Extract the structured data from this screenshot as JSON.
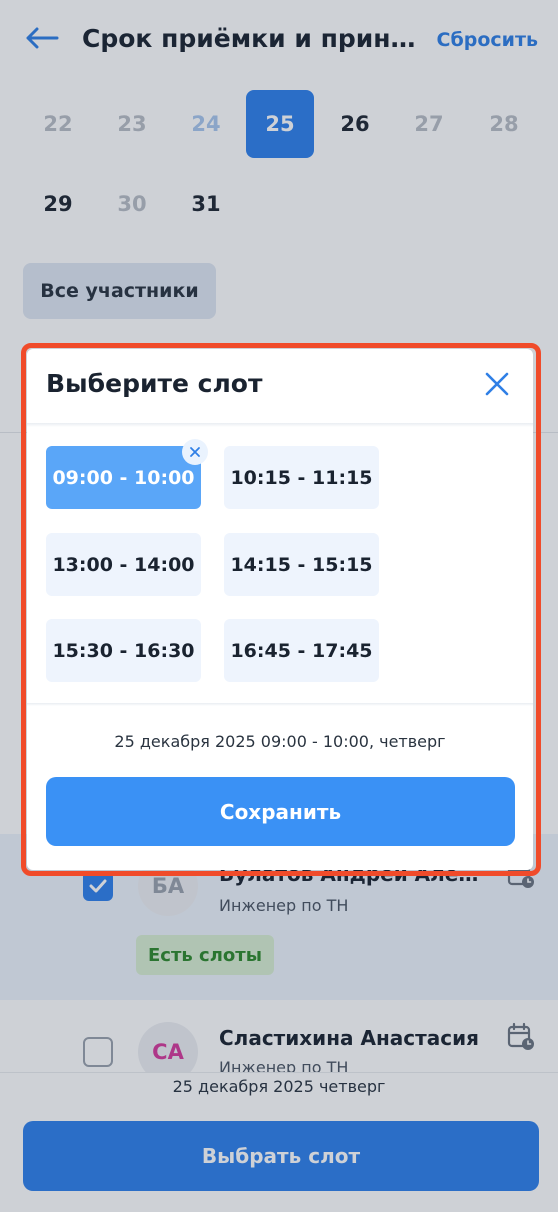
{
  "header": {
    "title": "Срок приёмки и прини...",
    "reset_label": "Сбросить",
    "back_icon": "arrow-left-icon"
  },
  "calendar": {
    "row1": [
      "22",
      "23",
      "24",
      "25",
      "26",
      "27",
      "28"
    ],
    "row2": [
      "29",
      "30",
      "31"
    ],
    "selected_day": "25"
  },
  "filter": {
    "all_participants_label": "Все участники"
  },
  "participants": [
    {
      "initials": "БА",
      "name": "Булатов Андрей Алекса...",
      "role": "Инженер по ТН",
      "checked": true,
      "badge": "Есть слоты",
      "initials_color": "#9aa2ad"
    },
    {
      "initials": "СА",
      "name": "Сластихина Анастасия",
      "role": "Инженер по ТН",
      "checked": false,
      "initials_color": "#d63a9c"
    }
  ],
  "bottom": {
    "date_text": "25 декабря 2025 четверг",
    "choose_slot_label": "Выбрать слот"
  },
  "modal": {
    "title": "Выберите слот",
    "slots": [
      "09:00 - 10:00",
      "10:15 - 11:15",
      "13:00 - 14:00",
      "14:15 - 15:15",
      "15:30 - 16:30",
      "16:45 - 17:45"
    ],
    "selected_slot": "09:00 - 10:00",
    "selected_info": "25 декабря 2025 09:00 - 10:00, четверг",
    "save_label": "Сохранить"
  },
  "colors": {
    "accent": "#2f80ec",
    "highlight_frame": "#f04b2a",
    "badge_green": "#2f8a2c"
  }
}
